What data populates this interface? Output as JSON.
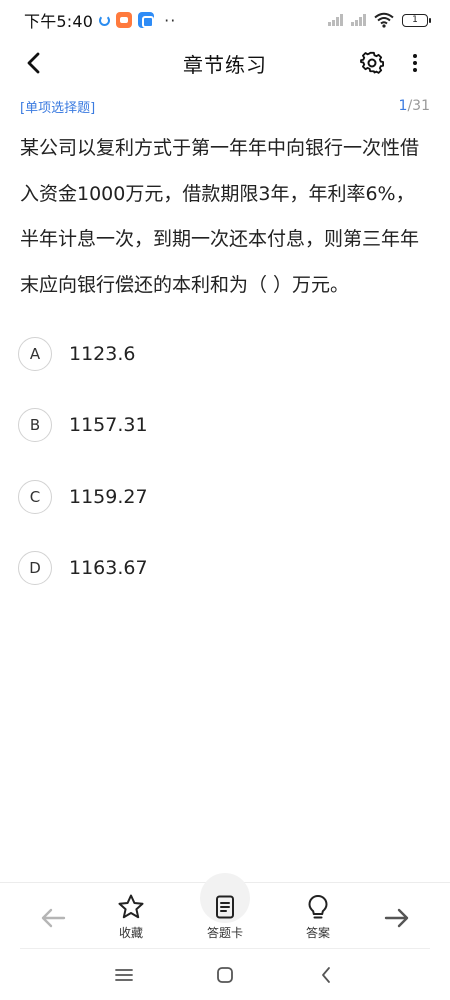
{
  "status_bar": {
    "time": "下午5:40",
    "more_dots": "··",
    "battery_level": "1"
  },
  "header": {
    "title": "章节练习",
    "back_icon": "chevron-left-icon",
    "settings_icon": "gear-icon",
    "more_icon": "vertical-dots-icon"
  },
  "question": {
    "type_label": "[单项选择题]",
    "current": "1",
    "total_display": "/31",
    "stem": "某公司以复利方式于第一年年中向银行一次性借入资金1000万元，借款期限3年，年利率6%，半年计息一次，到期一次还本付息，则第三年年末应向银行偿还的本利和为（    ）万元。",
    "options": [
      {
        "letter": "A",
        "text": "1123.6"
      },
      {
        "letter": "B",
        "text": "1157.31"
      },
      {
        "letter": "C",
        "text": "1159.27"
      },
      {
        "letter": "D",
        "text": "1163.67"
      }
    ]
  },
  "toolbar": {
    "favorite_label": "收藏",
    "answer_card_label": "答题卡",
    "answer_label": "答案",
    "prev_icon": "arrow-left-icon",
    "next_icon": "arrow-right-icon"
  },
  "colors": {
    "accent": "#3b7be0",
    "text": "#222222",
    "muted": "#999999"
  }
}
